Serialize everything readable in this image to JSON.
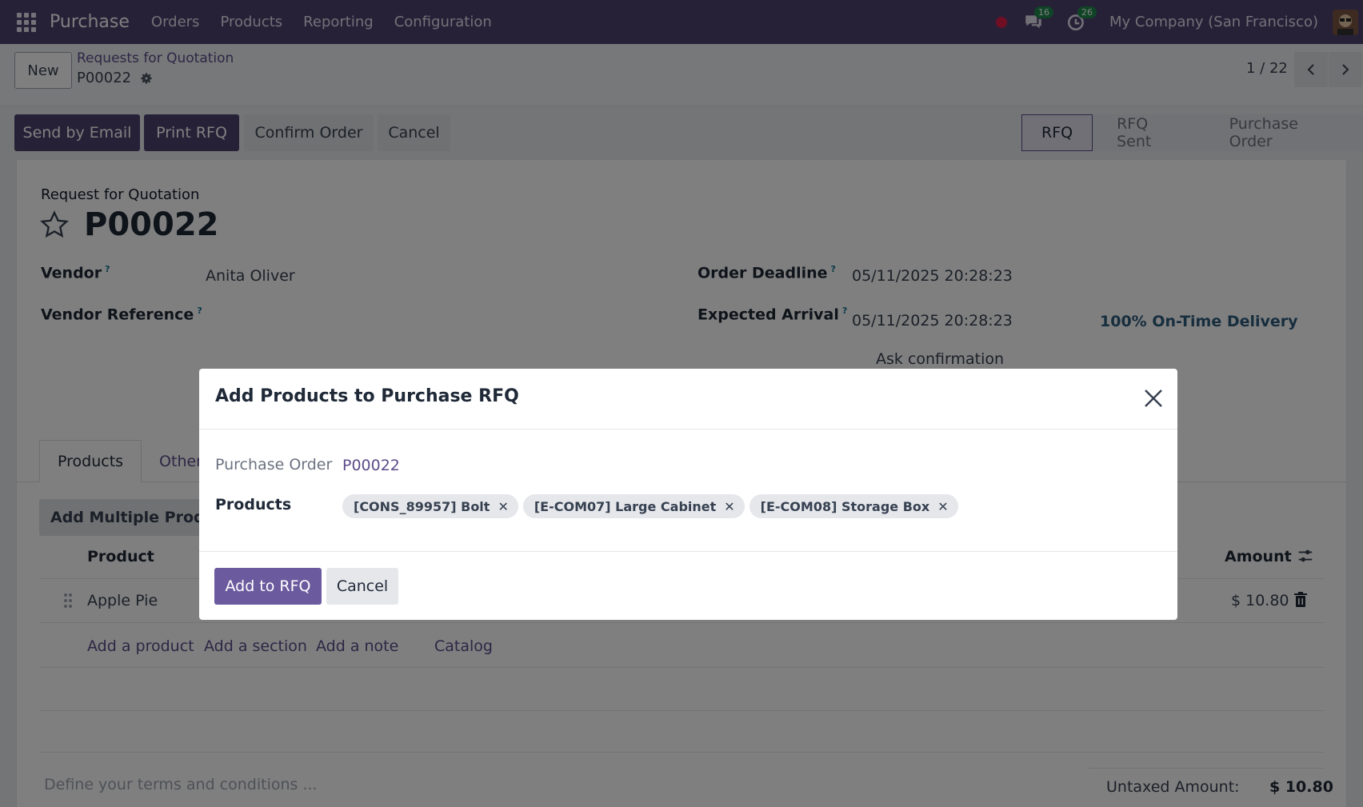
{
  "navbar": {
    "brand": "Purchase",
    "menu": [
      "Orders",
      "Products",
      "Reporting",
      "Configuration"
    ],
    "messages_count": "16",
    "activities_count": "26",
    "company": "My Company (San Francisco)"
  },
  "control": {
    "new_label": "New",
    "breadcrumb_parent": "Requests for Quotation",
    "breadcrumb_current": "P00022",
    "pager": "1 / 22"
  },
  "actions": {
    "send_email": "Send by Email",
    "print_rfq": "Print RFQ",
    "confirm_order": "Confirm Order",
    "cancel": "Cancel"
  },
  "statusbar": {
    "stages": [
      "RFQ",
      "RFQ Sent",
      "Purchase Order"
    ],
    "active": "RFQ"
  },
  "form": {
    "subtitle": "Request for Quotation",
    "title": "P00022",
    "vendor_label": "Vendor",
    "vendor_value": "Anita Oliver",
    "vendor_ref_label": "Vendor Reference",
    "order_deadline_label": "Order Deadline",
    "order_deadline_value": "05/11/2025 20:28:23",
    "expected_arrival_label": "Expected Arrival",
    "expected_arrival_value": "05/11/2025 20:28:23",
    "ontime_delivery": "100% On-Time Delivery",
    "ask_confirmation": "Ask confirmation",
    "help_marker": "?",
    "tabs": [
      "Products",
      "Other"
    ],
    "add_multiple": "Add Multiple Products",
    "col_product": "Product",
    "col_amount": "Amount",
    "lines": [
      {
        "product": "Apple Pie",
        "amount": "$ 10.80"
      }
    ],
    "add_product": "Add a product",
    "add_section": "Add a section",
    "add_note": "Add a note",
    "catalog": "Catalog",
    "terms_placeholder": "Define your terms and conditions ...",
    "untaxed_label": "Untaxed Amount:",
    "untaxed_value": "$ 10.80"
  },
  "modal": {
    "title": "Add Products to Purchase RFQ",
    "purchase_order_label": "Purchase Order",
    "purchase_order_value": "P00022",
    "products_label": "Products",
    "tags": [
      "[CONS_89957] Bolt",
      "[E-COM07] Large Cabinet",
      "[E-COM08] Storage Box"
    ],
    "add_button": "Add to RFQ",
    "cancel_button": "Cancel"
  },
  "colors": {
    "navbar": "#4e4270",
    "primary": "#4e4270",
    "link": "#5b4c8a",
    "modal_primary": "#6c5a9e"
  }
}
